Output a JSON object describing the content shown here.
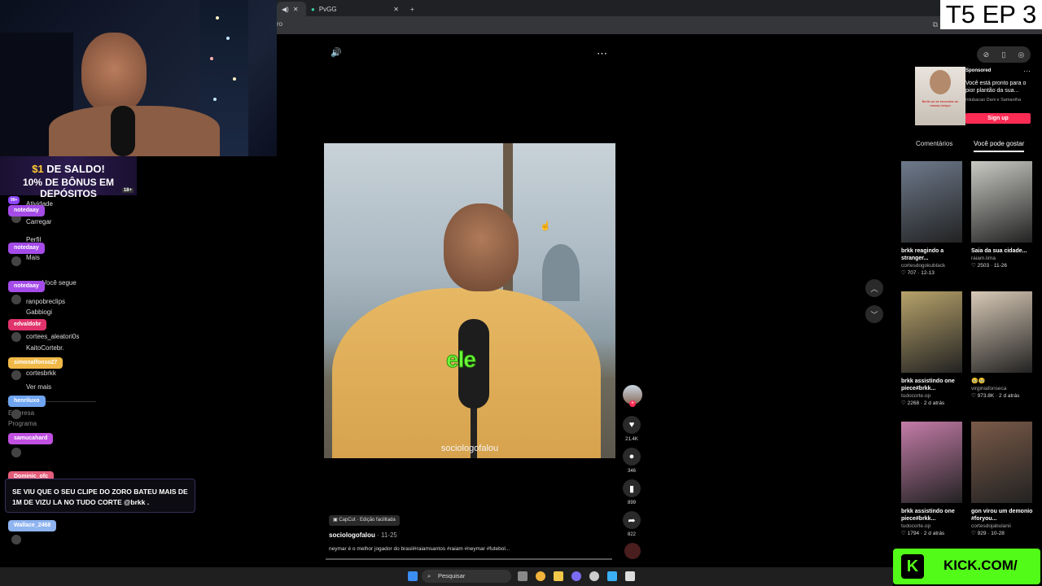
{
  "overlay": {
    "episode_label": "T5 EP 3"
  },
  "browser": {
    "tabs": [
      {
        "label": "",
        "active": true
      },
      {
        "label": "PvGG",
        "active": false
      }
    ],
    "address_fragment": "ro"
  },
  "promo": {
    "line1_amount": "$1",
    "line1_rest": " DE SALDO!",
    "line2": "10% DE BÔNUS EM DEPÓSITOS",
    "age": "18+"
  },
  "sidebar_menu": {
    "items": [
      "Atividade",
      "Carregar",
      "Perfil",
      "Mais"
    ],
    "following_header": "Você segue",
    "following": [
      "ranpobreclips",
      "Gabbiogi",
      "cortees_aleatori0s",
      "KaitoCortebr.",
      "cortesbrkk"
    ],
    "see_more": "Ver mais",
    "footer": [
      "Empresa",
      "Programa"
    ]
  },
  "chat": {
    "badge": "99+",
    "usernames": [
      "notedaay",
      "notedaay",
      "notedaay",
      "edvaldobr",
      "simonalfonso27",
      "henriluxo",
      "samucahard",
      "Dominic_ofc",
      "Wallace_2468"
    ],
    "highlight_message": "SE VIU QUE O SEU CLIPE DO ZORO BATEU MAIS DE 1M DE VIZU LA NO TUDO CORTE @brkk ."
  },
  "video": {
    "caption": "ele",
    "watermark": "sociologofalou",
    "capcut_tag": "CapCut · Edição facilitada",
    "author": "sociologofalou",
    "date": "· 11-25",
    "description": "neymar é o melhor jogador do brasil#raiamsantos #raiam #neymar #futebol...",
    "likes": "21.4K",
    "comments": "346",
    "saves": "899",
    "shares": "822",
    "more_icon": "⋯",
    "volume_icon": "🔊"
  },
  "right_panel": {
    "ad": {
      "sponsored": "Sponsored",
      "title": "Você está pronto para o pior plantão da sua...",
      "brand": "Intubacao Dani e Samantha",
      "cta": "Sign up",
      "image_text": "Berlin ao se encontrar ao mesmo tempo"
    },
    "tabs": [
      "Comentários",
      "Você pode gostar"
    ],
    "active_tab": 1,
    "cards": [
      {
        "title": "brkk reagindo a stranger...",
        "creator": "cortesdogokublack",
        "likes": "707",
        "date": "12-13",
        "thumb_color": "#6e7a8c"
      },
      {
        "title": "Saia da sua cidade...",
        "creator": "raiam.lima",
        "likes": "2503",
        "date": "11-26",
        "thumb_color": "#c9c9c4"
      },
      {
        "title": "brkk assistindo one piece#brkk...",
        "creator": "tudocorte.op",
        "likes": "2268",
        "date": "2 d atrás",
        "thumb_color": "#b7a26a"
      },
      {
        "title": "🥹🥹",
        "creator": "virginiafonseca",
        "likes": "973.8K",
        "date": "2 d atrás",
        "thumb_color": "#d8c9b6"
      },
      {
        "title": "brkk assistindo one piece#brkk...",
        "creator": "tudocorte.op",
        "likes": "1794",
        "date": "2 d atrás",
        "thumb_color": "#c47ca8"
      },
      {
        "title": "gon virou um demonio #foryou...",
        "creator": "cortesdojabulanii",
        "likes": "929",
        "date": "10-28",
        "thumb_color": "#7a5a48"
      }
    ]
  },
  "kick": {
    "logo": "K",
    "text": "KICK.COM/"
  },
  "taskbar": {
    "search_placeholder": "Pesquisar"
  },
  "colors": {
    "tiktok_red": "#fe2c55",
    "kick_green": "#53fc18",
    "chat_border": "#3a2d5c"
  }
}
